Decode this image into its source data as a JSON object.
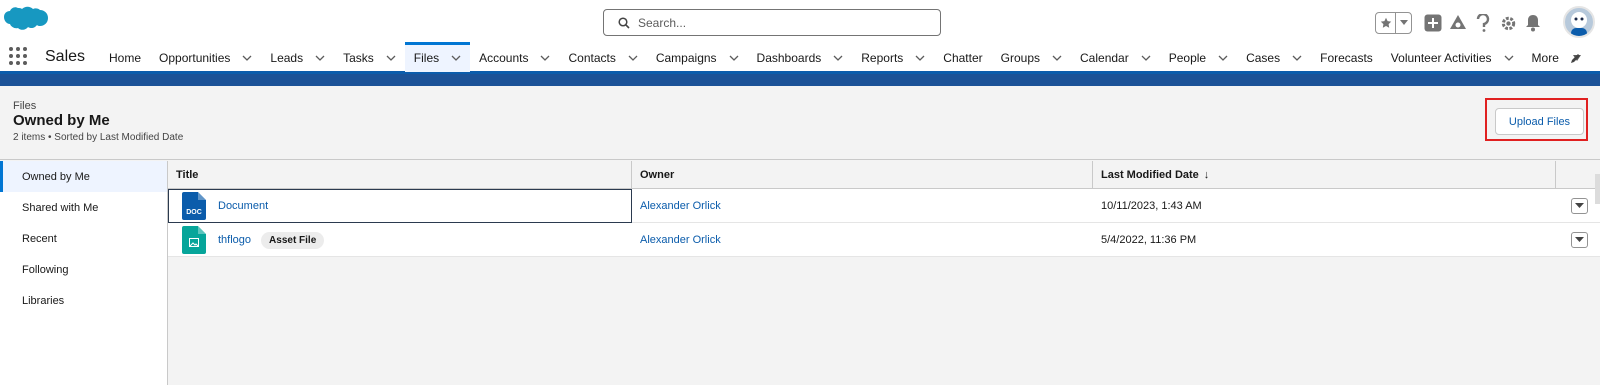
{
  "header": {
    "search_placeholder": "Search...",
    "icons": [
      "salesforce-cloud-icon",
      "search-icon",
      "star-icon",
      "chevron-down-icon",
      "add-icon",
      "trailhead-icon",
      "help-icon",
      "setup-gear-icon",
      "notifications-bell-icon",
      "avatar-icon"
    ]
  },
  "app": {
    "name": "Sales",
    "nav": [
      {
        "label": "Home",
        "chevron": false
      },
      {
        "label": "Opportunities",
        "chevron": true
      },
      {
        "label": "Leads",
        "chevron": true
      },
      {
        "label": "Tasks",
        "chevron": true
      },
      {
        "label": "Files",
        "chevron": true,
        "active": true
      },
      {
        "label": "Accounts",
        "chevron": true
      },
      {
        "label": "Contacts",
        "chevron": true
      },
      {
        "label": "Campaigns",
        "chevron": true
      },
      {
        "label": "Dashboards",
        "chevron": true
      },
      {
        "label": "Reports",
        "chevron": true
      },
      {
        "label": "Chatter",
        "chevron": false
      },
      {
        "label": "Groups",
        "chevron": true
      },
      {
        "label": "Calendar",
        "chevron": true
      },
      {
        "label": "People",
        "chevron": true
      },
      {
        "label": "Cases",
        "chevron": true
      },
      {
        "label": "Forecasts",
        "chevron": false
      },
      {
        "label": "Volunteer Activities",
        "chevron": true
      },
      {
        "label": "More",
        "chevron": false,
        "more": true
      }
    ]
  },
  "page": {
    "breadcrumb": "Files",
    "title": "Owned by Me",
    "subtitle": "2 items • Sorted by Last Modified Date",
    "upload_button": "Upload Files"
  },
  "sidebar": {
    "items": [
      {
        "label": "Owned by Me",
        "active": true
      },
      {
        "label": "Shared with Me"
      },
      {
        "label": "Recent"
      },
      {
        "label": "Following"
      },
      {
        "label": "Libraries"
      }
    ]
  },
  "table": {
    "columns": [
      "Title",
      "Owner",
      "Last Modified Date",
      ""
    ],
    "sort_indicator": "↓",
    "rows": [
      {
        "title": "Document",
        "icon": "doc",
        "icon_label": "DOC",
        "badge": "",
        "owner": "Alexander Orlick",
        "modified": "10/11/2023, 1:43 AM"
      },
      {
        "title": "thflogo",
        "icon": "image",
        "icon_label": "",
        "badge": "Asset File",
        "owner": "Alexander Orlick",
        "modified": "5/4/2022, 11:36 PM"
      }
    ]
  },
  "colors": {
    "brand": "#0176d3",
    "link": "#0b5cab",
    "band": "#1b5297",
    "doc_icon": "#0b5cab",
    "image_icon": "#06a59a",
    "highlight": "#e02020"
  }
}
